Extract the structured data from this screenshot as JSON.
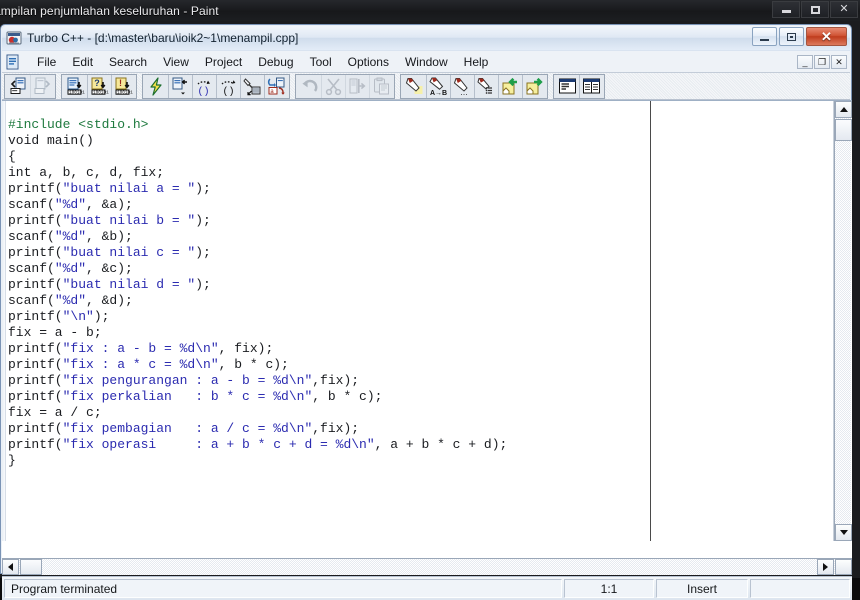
{
  "paint_window": {
    "title": "ampilan penjumlahan keseluruhan - Paint",
    "buttons": [
      {
        "name": "minimize",
        "glyph": "min"
      },
      {
        "name": "maximize",
        "glyph": "max"
      },
      {
        "name": "close",
        "glyph": "✕"
      }
    ]
  },
  "turbo_window": {
    "title": "Turbo C++ - [d:\\master\\baru\\ioik2~1\\menampil.cpp]",
    "app_icon": "turbo-cpp-icon",
    "buttons": [
      {
        "name": "minimize",
        "glyph": "min"
      },
      {
        "name": "restore",
        "glyph": "restore"
      },
      {
        "name": "close",
        "glyph": "✕"
      }
    ]
  },
  "menubar": {
    "doc_icon": "document-icon",
    "items": [
      {
        "label": "File"
      },
      {
        "label": "Edit"
      },
      {
        "label": "Search"
      },
      {
        "label": "View"
      },
      {
        "label": "Project"
      },
      {
        "label": "Debug"
      },
      {
        "label": "Tool"
      },
      {
        "label": "Options"
      },
      {
        "label": "Window"
      },
      {
        "label": "Help"
      }
    ],
    "mdi_buttons": [
      {
        "label": "_",
        "name": "mdi-minimize"
      },
      {
        "label": "❐",
        "name": "mdi-restore"
      },
      {
        "label": "✕",
        "name": "mdi-close"
      }
    ]
  },
  "toolbar": {
    "groups": [
      {
        "name": "file-group",
        "buttons": [
          {
            "name": "open-file-icon",
            "disabled": false
          },
          {
            "name": "save-file-icon",
            "disabled": true
          }
        ]
      },
      {
        "name": "compile-group",
        "buttons": [
          {
            "name": "compile-icon",
            "disabled": false
          },
          {
            "name": "make-icon",
            "disabled": false
          },
          {
            "name": "build-icon",
            "disabled": false
          }
        ]
      },
      {
        "name": "run-group",
        "buttons": [
          {
            "name": "run-lightning-icon",
            "disabled": false
          },
          {
            "name": "step-over-icon",
            "disabled": false
          },
          {
            "name": "trace-into-icon",
            "disabled": false
          },
          {
            "name": "step-out-icon",
            "disabled": false
          },
          {
            "name": "inspect-icon",
            "disabled": false
          },
          {
            "name": "watch-icon",
            "disabled": false
          }
        ]
      },
      {
        "name": "edit-group",
        "buttons": [
          {
            "name": "undo-icon",
            "disabled": true
          },
          {
            "name": "cut-icon",
            "disabled": true
          },
          {
            "name": "copy-icon",
            "disabled": true
          },
          {
            "name": "paste-icon",
            "disabled": true
          }
        ]
      },
      {
        "name": "search-group",
        "buttons": [
          {
            "name": "find-icon",
            "disabled": false
          },
          {
            "name": "replace-icon",
            "disabled": false
          },
          {
            "name": "search-again-icon",
            "disabled": false
          },
          {
            "name": "goto-icon",
            "disabled": false
          },
          {
            "name": "prev-bookmark-icon",
            "disabled": false
          },
          {
            "name": "next-bookmark-icon",
            "disabled": false
          }
        ]
      },
      {
        "name": "window-group",
        "buttons": [
          {
            "name": "cascade-windows-icon",
            "disabled": false
          },
          {
            "name": "tile-windows-icon",
            "disabled": false
          }
        ]
      }
    ]
  },
  "editor": {
    "margin_column_x": 648,
    "code_lines": [
      [
        {
          "t": "#include <stdio.h>",
          "c": "pre"
        }
      ],
      [
        {
          "t": "void main()",
          "c": "txt"
        }
      ],
      [
        {
          "t": "{",
          "c": "txt"
        }
      ],
      [
        {
          "t": "int a, b, c, d, fix;",
          "c": "txt"
        }
      ],
      [
        {
          "t": "printf(",
          "c": "txt"
        },
        {
          "t": "\"buat nilai a = \"",
          "c": "str"
        },
        {
          "t": ");",
          "c": "txt"
        }
      ],
      [
        {
          "t": "scanf(",
          "c": "txt"
        },
        {
          "t": "\"%d\"",
          "c": "str"
        },
        {
          "t": ", &a);",
          "c": "txt"
        }
      ],
      [
        {
          "t": "printf(",
          "c": "txt"
        },
        {
          "t": "\"buat nilai b = \"",
          "c": "str"
        },
        {
          "t": ");",
          "c": "txt"
        }
      ],
      [
        {
          "t": "scanf(",
          "c": "txt"
        },
        {
          "t": "\"%d\"",
          "c": "str"
        },
        {
          "t": ", &b);",
          "c": "txt"
        }
      ],
      [
        {
          "t": "printf(",
          "c": "txt"
        },
        {
          "t": "\"buat nilai c = \"",
          "c": "str"
        },
        {
          "t": ");",
          "c": "txt"
        }
      ],
      [
        {
          "t": "scanf(",
          "c": "txt"
        },
        {
          "t": "\"%d\"",
          "c": "str"
        },
        {
          "t": ", &c);",
          "c": "txt"
        }
      ],
      [
        {
          "t": "printf(",
          "c": "txt"
        },
        {
          "t": "\"buat nilai d = \"",
          "c": "str"
        },
        {
          "t": ");",
          "c": "txt"
        }
      ],
      [
        {
          "t": "scanf(",
          "c": "txt"
        },
        {
          "t": "\"%d\"",
          "c": "str"
        },
        {
          "t": ", &d);",
          "c": "txt"
        }
      ],
      [
        {
          "t": "printf(",
          "c": "txt"
        },
        {
          "t": "\"\\n\"",
          "c": "str"
        },
        {
          "t": ");",
          "c": "txt"
        }
      ],
      [
        {
          "t": "fix = a - b;",
          "c": "txt"
        }
      ],
      [
        {
          "t": "printf(",
          "c": "txt"
        },
        {
          "t": "\"fix : a - b = %d\\n\"",
          "c": "str"
        },
        {
          "t": ", fix);",
          "c": "txt"
        }
      ],
      [
        {
          "t": "printf(",
          "c": "txt"
        },
        {
          "t": "\"fix : a * c = %d\\n\"",
          "c": "str"
        },
        {
          "t": ", b * c);",
          "c": "txt"
        }
      ],
      [
        {
          "t": "printf(",
          "c": "txt"
        },
        {
          "t": "\"fix pengurangan : a - b = %d\\n\"",
          "c": "str"
        },
        {
          "t": ",fix);",
          "c": "txt"
        }
      ],
      [
        {
          "t": "printf(",
          "c": "txt"
        },
        {
          "t": "\"fix perkalian   : b * c = %d\\n\"",
          "c": "str"
        },
        {
          "t": ", b * c);",
          "c": "txt"
        }
      ],
      [
        {
          "t": "fix = a / c;",
          "c": "txt"
        }
      ],
      [
        {
          "t": "printf(",
          "c": "txt"
        },
        {
          "t": "\"fix pembagian   : a / c = %d\\n\"",
          "c": "str"
        },
        {
          "t": ",fix);",
          "c": "txt"
        }
      ],
      [
        {
          "t": "printf(",
          "c": "txt"
        },
        {
          "t": "\"fix operasi     : a + b * c + d = %d\\n\"",
          "c": "str"
        },
        {
          "t": ", a + b * c + d);",
          "c": "txt"
        }
      ],
      [
        {
          "t": "}",
          "c": "txt"
        }
      ]
    ]
  },
  "statusbar": {
    "message": "Program terminated",
    "position": "1:1",
    "mode": "Insert",
    "tail": ""
  },
  "colors": {
    "preprocessor": "#1f7a3f",
    "string": "#2b2bb0",
    "plain": "#1a1c20",
    "editor_bg": "#ffffff",
    "titlebar_accent": "#cf5334"
  }
}
